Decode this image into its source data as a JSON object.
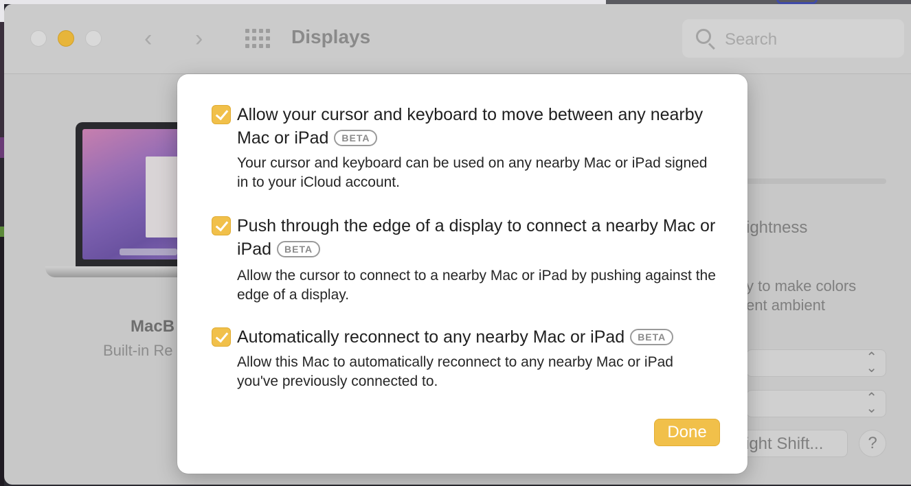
{
  "window": {
    "title": "Displays",
    "search_placeholder": "Search"
  },
  "background": {
    "device_name": "MacB",
    "device_subtitle": "Built-in Re",
    "brightness_label": "ightness",
    "true_tone_line1": "y to make colors",
    "true_tone_line2": "ent ambient",
    "night_shift_label": "ight Shift...",
    "help_label": "?"
  },
  "sheet": {
    "options": [
      {
        "checked": true,
        "title": "Allow your cursor and keyboard to move between any nearby Mac or iPad",
        "badge": "BETA",
        "description": "Your cursor and keyboard can be used on any nearby Mac or iPad signed in to your iCloud account."
      },
      {
        "checked": true,
        "title": "Push through the edge of a display to connect a nearby Mac or iPad",
        "badge": "BETA",
        "description": "Allow the cursor to connect to a nearby Mac or iPad by pushing against the edge of a display."
      },
      {
        "checked": true,
        "title": "Automatically reconnect to any nearby Mac or iPad",
        "badge": "BETA",
        "description": "Allow this Mac to automatically reconnect to any nearby Mac or iPad you've previously connected to."
      }
    ],
    "done_label": "Done"
  },
  "colors": {
    "accent": "#f1c04a",
    "window_dim": "#c8c8c8"
  }
}
